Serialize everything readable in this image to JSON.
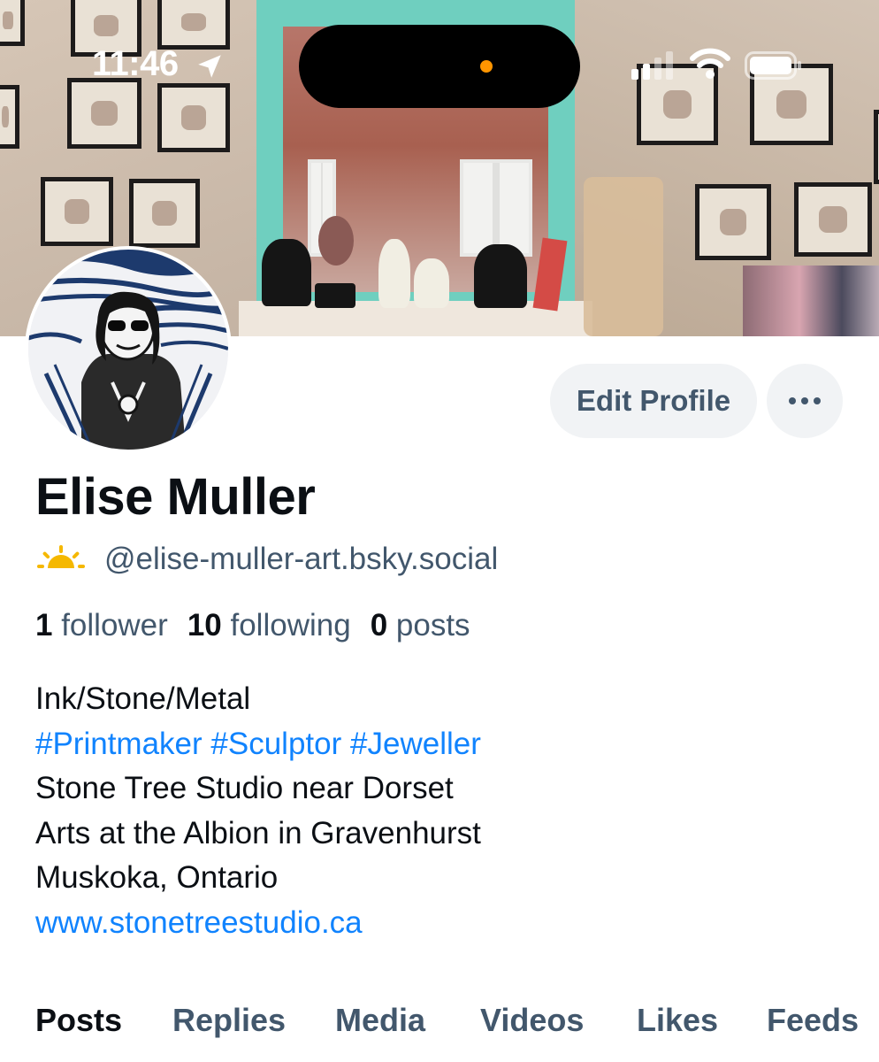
{
  "status_bar": {
    "time": "11:46"
  },
  "profile": {
    "display_name": "Elise Muller",
    "handle": "@elise-muller-art.bsky.social",
    "edit_button": "Edit Profile",
    "more_button": "•••"
  },
  "stats": {
    "followers_count": "1",
    "followers_label": "follower",
    "following_count": "10",
    "following_label": "following",
    "posts_count": "0",
    "posts_label": "posts"
  },
  "bio": {
    "line1": "Ink/Stone/Metal",
    "tags": [
      "#Printmaker",
      "#Sculptor",
      "#Jeweller"
    ],
    "line3": "Stone Tree Studio near Dorset",
    "line4": "Arts at the Albion in Gravenhurst",
    "line5": "Muskoka, Ontario",
    "website": "www.stonetreestudio.ca"
  },
  "tabs": [
    "Posts",
    "Replies",
    "Media",
    "Videos",
    "Likes",
    "Feeds"
  ],
  "colors": {
    "accent": "#1083fe",
    "muted_text": "#42576c",
    "button_bg": "#f1f3f5",
    "notch_dot": "#ff9500",
    "sun": "#f5b800"
  }
}
